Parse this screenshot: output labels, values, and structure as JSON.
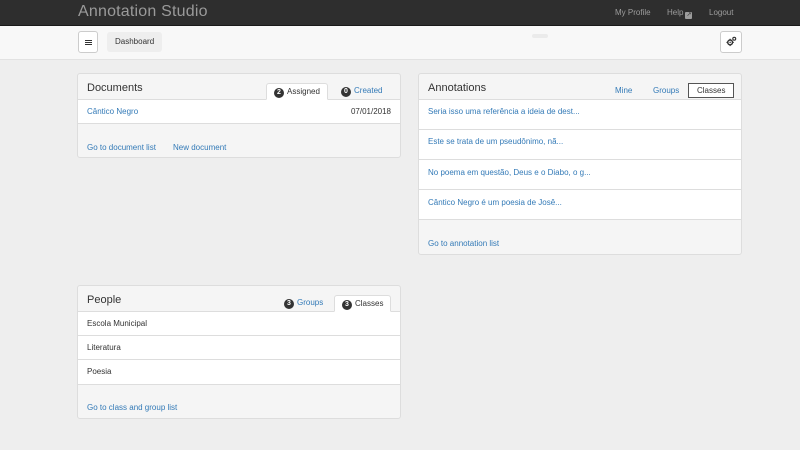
{
  "app": {
    "brand": "Annotation Studio"
  },
  "topnav": {
    "profile": "My Profile",
    "help": "Help",
    "help_icon": "↗",
    "logout": "Logout"
  },
  "toolbar": {
    "dashboard": "Dashboard",
    "menu_icon": "hamburger-icon",
    "settings_icon": "gears-icon"
  },
  "documents": {
    "title": "Documents",
    "tabs": [
      {
        "count": "2",
        "label": "Assigned",
        "active": true
      },
      {
        "count": "0",
        "label": "Created",
        "active": false
      }
    ],
    "rows": [
      {
        "title": "Cântico Negro",
        "date": "07/01/2018"
      }
    ],
    "links": {
      "list": "Go to document list",
      "new": "New document"
    }
  },
  "annotations": {
    "title": "Annotations",
    "tabs": [
      "Mine",
      "Groups",
      "Classes"
    ],
    "active_tab": "Classes",
    "rows": [
      "Seria isso uma referência a ideia de dest...",
      "Este se trata de um pseudônimo, nã...",
      "No poema em questão, Deus e o Diabo, o g...",
      "Cântico Negro é um poesia de Josê..."
    ],
    "link": "Go to annotation list"
  },
  "people": {
    "title": "People",
    "tabs": [
      {
        "count": "3",
        "label": "Groups",
        "active": false
      },
      {
        "count": "3",
        "label": "Classes",
        "active": true
      }
    ],
    "rows": [
      "Escola Municipal",
      "Literatura",
      "Poesia"
    ],
    "link": "Go to class and group list"
  }
}
